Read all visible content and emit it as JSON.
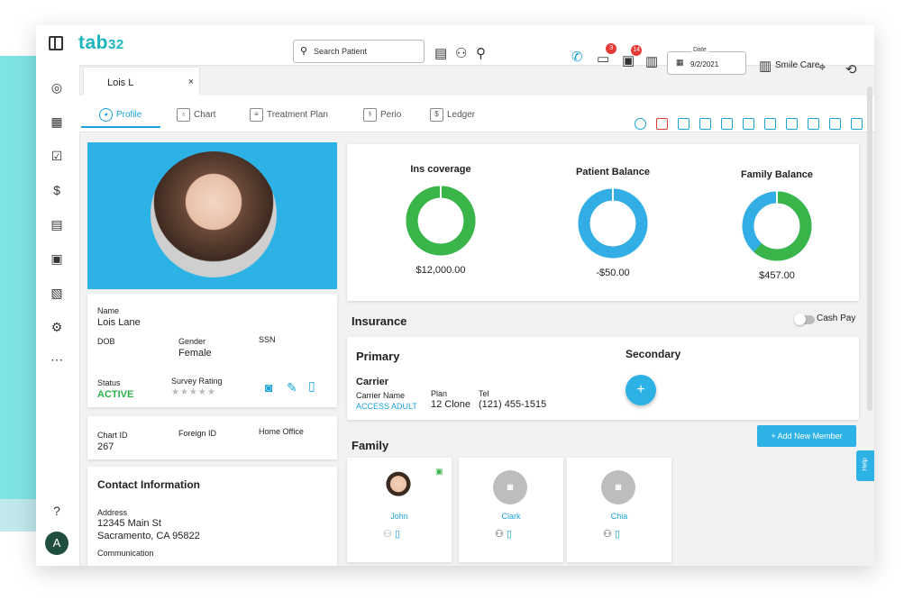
{
  "app": {
    "logo": "tab",
    "logo_suffix": "32"
  },
  "topbar": {
    "search_placeholder": "Search Patient",
    "badges": {
      "messages": "3",
      "chat": "14"
    },
    "date_label": "Date",
    "date_value": "9/2/2021",
    "office": "Smile Care"
  },
  "patient_tab": {
    "name": "Lois L",
    "close": "×"
  },
  "tabs": [
    "Profile",
    "Chart",
    "Treatment Plan",
    "Perio",
    "Ledger"
  ],
  "patient": {
    "name_label": "Name",
    "name": "Lois Lane",
    "dob_label": "DOB",
    "dob": "",
    "gender_label": "Gender",
    "gender": "Female",
    "ssn_label": "SSN",
    "ssn": "",
    "status_label": "Status",
    "status": "ACTIVE",
    "survey_label": "Survey Rating",
    "survey_stars": "★★★★★",
    "chart_id_label": "Chart ID",
    "chart_id": "267",
    "foreign_id_label": "Foreign ID",
    "home_office_label": "Home Office"
  },
  "contact": {
    "title": "Contact Information",
    "address_label": "Address",
    "address_line1": "12345 Main St",
    "address_line2": "Sacramento, CA 95822",
    "communication_label": "Communication"
  },
  "balances": [
    {
      "label": "Ins coverage",
      "value": "$12,000.00",
      "fraction": 0.98,
      "color": "#3ab54a",
      "rest": "#3ab54a"
    },
    {
      "label": "Patient Balance",
      "value": "-$50.00",
      "fraction": 0.99,
      "color": "#33aee4",
      "rest": "#33aee4"
    },
    {
      "label": "Family Balance",
      "value": "$457.00",
      "fraction": 0.62,
      "color": "#3ab54a",
      "rest": "#33aee4"
    }
  ],
  "insurance": {
    "title": "Insurance",
    "cash_pay": "Cash Pay",
    "primary": "Primary",
    "secondary": "Secondary",
    "carrier": "Carrier",
    "carrier_name_label": "Carrier Name",
    "carrier_name": "ACCESS ADULT",
    "plan_label": "Plan",
    "plan": "12 Clone",
    "tel_label": "Tel",
    "tel": "(121) 455-1515",
    "add_symbol": "+"
  },
  "family": {
    "title": "Family",
    "add_button": "+ Add New Member",
    "members": [
      "John",
      "Clark",
      "Chia"
    ]
  },
  "help": "Help",
  "avatar_initial": "A"
}
